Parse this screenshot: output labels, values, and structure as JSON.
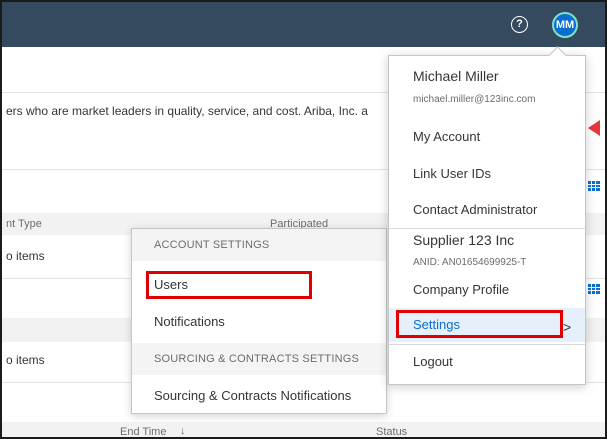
{
  "header": {
    "help_icon": "?",
    "avatar_initials": "MM"
  },
  "background": {
    "intro_text": "ers who are market leaders in quality, service, and cost. Ariba, Inc. a",
    "column_type": "nt Type",
    "column_participated": "Participated",
    "no_items_1": "o items",
    "no_items_2": "o items",
    "column_end_time": "End Time",
    "sort_indicator": "↓",
    "column_status": "Status"
  },
  "account_settings_popover": {
    "heading": "ACCOUNT SETTINGS",
    "items": [
      "Users",
      "Notifications"
    ],
    "sourcing_heading": "SOURCING & CONTRACTS SETTINGS",
    "sourcing_items": [
      "Sourcing & Contracts Notifications"
    ]
  },
  "user_menu": {
    "name": "Michael Miller",
    "email": "michael.miller@123inc.com",
    "items": [
      "My Account",
      "Link User IDs",
      "Contact Administrator"
    ],
    "company": "Supplier 123 Inc",
    "anid": "ANID: AN01654699925-T",
    "company_items": [
      "Company Profile",
      "Settings"
    ],
    "logout": "Logout",
    "settings_chevron": ">"
  },
  "colors": {
    "shell": "#354a5f",
    "accent": "#0a6ed1",
    "highlight_box": "#e00000"
  }
}
